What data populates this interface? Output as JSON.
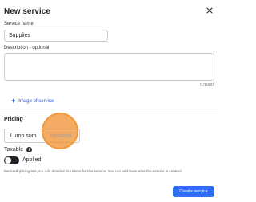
{
  "dialog": {
    "title": "New service",
    "close_icon": "close-icon"
  },
  "form": {
    "service_name_label": "Service name",
    "service_name_value": "Supplies",
    "description_label": "Description - optional",
    "description_value": "",
    "char_counter": "0/1000",
    "add_image_label": "Image of service",
    "add_image_icon": "+"
  },
  "pricing": {
    "heading": "Pricing",
    "options": [
      "Lump sum",
      "Itemized"
    ],
    "selected": "Itemized"
  },
  "taxable": {
    "label": "Taxable",
    "info_icon": "i",
    "toggle_on": true,
    "toggle_label": "Applied"
  },
  "help_text": "Itemized pricing lets you add detailed line items for this service. You can add them after the service is created.",
  "actions": {
    "create_label": "Create service"
  },
  "colors": {
    "primary": "#2f6df6",
    "link": "#2457d6",
    "click_indicator": "#f39a3c"
  }
}
